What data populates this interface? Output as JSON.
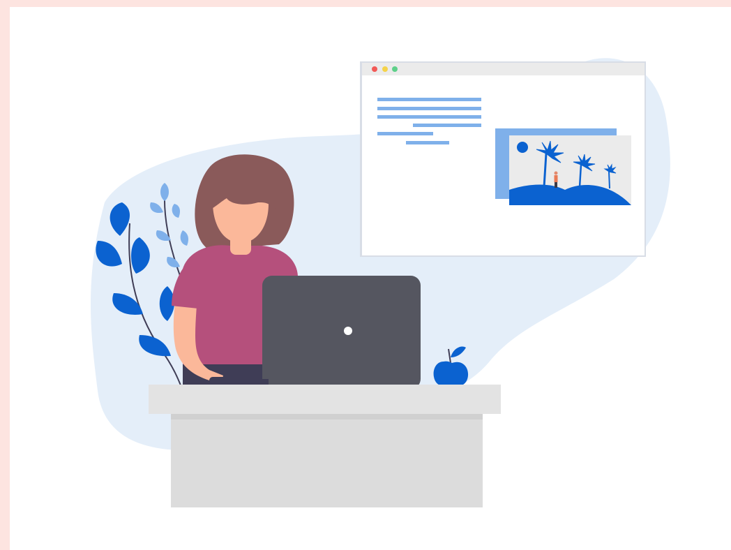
{
  "illustration": {
    "subject": "woman-working-at-laptop-on-desk",
    "icons": [
      "browser-window-icon",
      "plant-icon",
      "apple-icon",
      "laptop-icon"
    ]
  },
  "colors": {
    "page_border": "#fde4e0",
    "card": "#ffffff",
    "backdrop_blob": "#e4eef9",
    "accent_blue": "#0b62d0",
    "light_blue": "#7fb0ea",
    "hair": "#8a5a5a",
    "skin": "#fbb89a",
    "shirt": "#b5507c",
    "laptop": "#555660",
    "desk_top": "#e3e3e3",
    "desk_body": "#dcdcdc",
    "window_bar": "#ebebeb",
    "window_dot_red": "#f25a57",
    "window_dot_yellow": "#f5d34a",
    "window_dot_green": "#5ed08a"
  }
}
